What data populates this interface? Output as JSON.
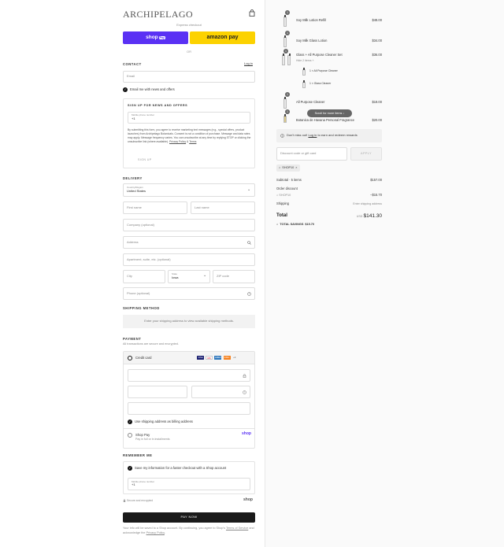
{
  "header": {
    "logo": "ARCHIPELAGO",
    "cart_icon": "shopping-bag-icon"
  },
  "express": {
    "label": "Express checkout",
    "shop_pay": "shop",
    "shop_pay_badge": "Pay",
    "amazon_pay": "amazon pay",
    "or": "OR"
  },
  "contact": {
    "title": "CONTACT",
    "login_link": "Log in",
    "email_placeholder": "Email",
    "email_news_label": "Email me with news and offers"
  },
  "signup": {
    "title": "SIGN UP FOR NEWS AND OFFERS",
    "phone_label": "Mobile phone number",
    "phone_value": "+1",
    "disclaimer": "By submitting this form, you agree to receive marketing text messages (e.g., special offers, product launches) from Archipelago Botanicals. Consent is not a condition of purchase. Message and data rates may apply. Message frequency varies. You can unsubscribe at any time by replying STOP or clicking the unsubscribe link (where available).",
    "privacy_link": "Privacy Policy",
    "terms_link": "Terms",
    "button": "SIGN UP"
  },
  "delivery": {
    "title": "DELIVERY",
    "country_label": "Country/Region",
    "country_value": "United States",
    "first_name": "First name",
    "last_name": "Last name",
    "company": "Company (optional)",
    "address": "Address",
    "apartment": "Apartment, suite, etc. (optional)",
    "city": "City",
    "state_label": "State",
    "state_value": "Iowa",
    "zip": "ZIP code",
    "phone": "Phone (optional)"
  },
  "shipping_method": {
    "title": "SHIPPING METHOD",
    "message": "Enter your shipping address to view available shipping methods."
  },
  "payment": {
    "title": "PAYMENT",
    "subtitle": "All transactions are secure and encrypted.",
    "credit_card_label": "Credit card",
    "card_brands": [
      "VISA",
      "MC",
      "AMEX",
      "DISC"
    ],
    "more_brands": "+3",
    "use_shipping_label": "Use shipping address as billing address",
    "shop_pay_label": "Shop Pay",
    "shop_pay_sub": "Pay in full or in installments",
    "shop_pay_logo": "shop"
  },
  "remember": {
    "title": "REMEMBER ME",
    "save_label": "Save my information for a faster checkout with a Shop account",
    "phone_label": "Mobile phone number",
    "phone_value": "+1",
    "secure_label": "Secure and encrypted",
    "shop_logo": "shop"
  },
  "pay_now": "PAY NOW",
  "footer_note": "Your info will be saved to a Shop account. By continuing, you agree to Shop's",
  "footer_terms": "Terms of Service",
  "footer_mid": "and acknowledge the",
  "footer_privacy": "Privacy Policy",
  "cart": {
    "items": [
      {
        "qty": "1",
        "name": "Soy Milk Lotion Refill",
        "price": "$48.00"
      },
      {
        "qty": "1",
        "name": "Soy Milk Glass Lotion",
        "price": "$34.00"
      },
      {
        "qty": "1",
        "name": "Glass + All Purpose Cleaner Set",
        "price": "$36.00",
        "sub_toggle": "Hide 2 items",
        "sub_items": [
          "1 × All Purpose Cleaner",
          "1 × Glass Cleaner"
        ]
      },
      {
        "qty": "1",
        "name": "All Purpose Cleaner",
        "price": "$19.00"
      },
      {
        "qty": "1",
        "name": "Botanica de Havana Personal Fragrance",
        "price": "$20.00"
      }
    ],
    "scroll_tip": "Scroll for more items"
  },
  "rewards": {
    "text_before": "Don't miss out!",
    "link": "Log in",
    "text_after": "to earn and redeem rewards"
  },
  "discount": {
    "placeholder": "Discount code or gift card",
    "apply": "APPLY",
    "applied_code": "SHOP10"
  },
  "summary": {
    "subtotal_label": "Subtotal · 5 items",
    "subtotal_value": "$157.00",
    "order_discount_label": "Order discount",
    "discount_code": "SHOP10",
    "discount_value": "−$15.70",
    "shipping_label": "Shipping",
    "shipping_value": "Enter shipping address",
    "total_label": "Total",
    "currency": "USD",
    "total_value": "$141.30",
    "savings_label": "TOTAL SAVINGS",
    "savings_value": "$15.70"
  },
  "colors": {
    "shop_pay": "#5a31f4",
    "amazon": "#fcd200",
    "pay_now": "#1a1a1a"
  }
}
